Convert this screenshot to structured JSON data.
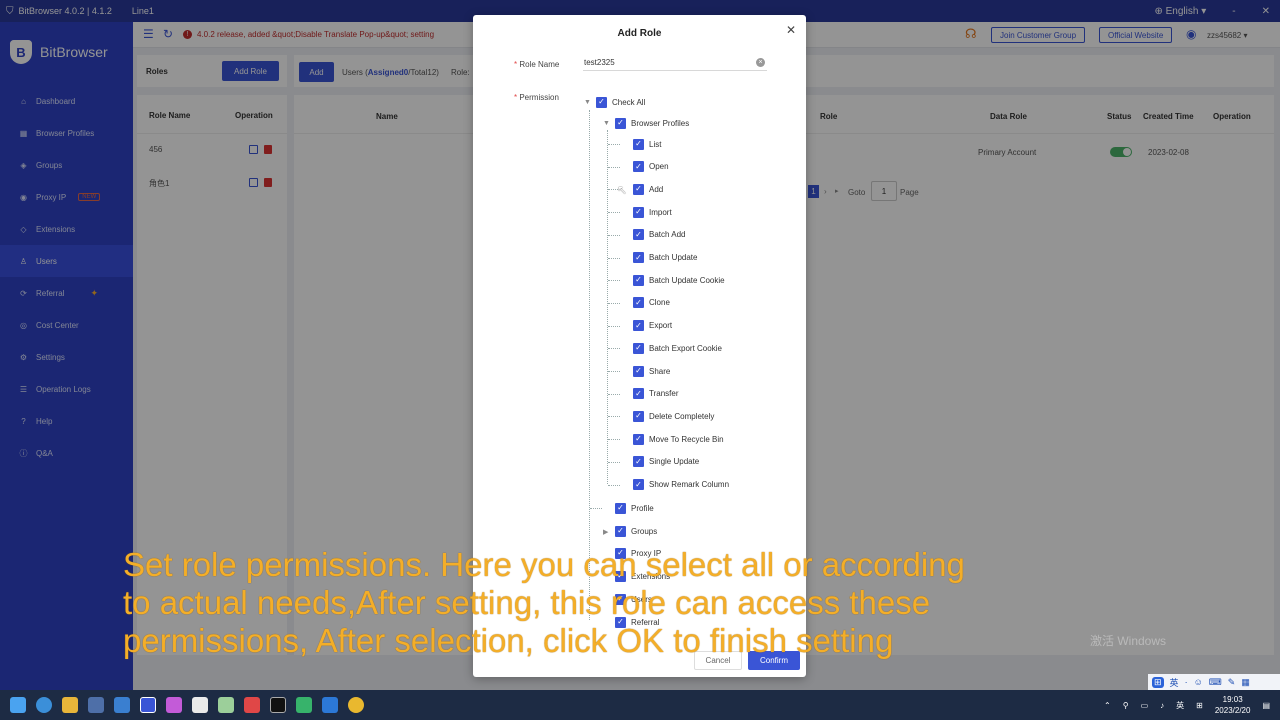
{
  "titlebar": {
    "app": "BitBrowser 4.0.2 | 4.1.2",
    "line": "Line1",
    "language": "English",
    "minimize": "-",
    "close": "✕"
  },
  "sidebar": {
    "logo": "BitBrowser",
    "items": [
      {
        "icon": "dashboard-icon",
        "glyph": "⌂",
        "label": "Dashboard"
      },
      {
        "icon": "browser-profiles-icon",
        "glyph": "▦",
        "label": "Browser Profiles"
      },
      {
        "icon": "groups-icon",
        "glyph": "◈",
        "label": "Groups"
      },
      {
        "icon": "proxy-icon",
        "glyph": "◉",
        "label": "Proxy IP",
        "badge": "NEW"
      },
      {
        "icon": "extensions-icon",
        "glyph": "◇",
        "label": "Extensions"
      },
      {
        "icon": "users-icon",
        "glyph": "♙",
        "label": "Users",
        "active": true
      },
      {
        "icon": "referral-icon",
        "glyph": "⟳",
        "label": "Referral",
        "star": "✦"
      },
      {
        "icon": "cost-center-icon",
        "glyph": "◎",
        "label": "Cost Center"
      },
      {
        "icon": "settings-icon",
        "glyph": "⚙",
        "label": "Settings"
      },
      {
        "icon": "operation-logs-icon",
        "glyph": "☰",
        "label": "Operation Logs"
      },
      {
        "icon": "help-icon",
        "glyph": "?",
        "label": "Help"
      },
      {
        "icon": "qa-icon",
        "glyph": "ⓘ",
        "label": "Q&A"
      }
    ]
  },
  "topbar": {
    "notice": "4.0.2 release, added &quot;Disable Translate Pop-up&quot; setting",
    "join_group": "Join Customer Group",
    "official_website": "Official Website",
    "username": "zzs45682"
  },
  "roles_panel": {
    "title": "Roles",
    "add_role": "Add Role",
    "col_role_name": "Role Name",
    "col_operation": "Operation",
    "rows": [
      "456",
      "角色1"
    ]
  },
  "users_panel": {
    "add": "Add",
    "users_label": "Users (",
    "assigned": "Assigned0",
    "total": "/Total12)",
    "role_label": "Role:",
    "columns": {
      "name": "Name",
      "role": "Role",
      "data_role": "Data Role",
      "status": "Status",
      "created": "Created Time",
      "operation": "Operation"
    },
    "row": {
      "data_role": "Primary Account",
      "created": "2023-02-08"
    },
    "pagination": {
      "page": "1",
      "goto": "Goto",
      "goto_value": "1",
      "page_label": "Page"
    }
  },
  "modal": {
    "title": "Add Role",
    "role_name_label": "Role Name",
    "role_name_value": "test2325",
    "permission_label": "Permission",
    "check_all": "Check All",
    "browser_profiles": "Browser Profiles",
    "children": [
      "List",
      "Open",
      "Add",
      "Import",
      "Batch Add",
      "Batch Update",
      "Batch Update Cookie",
      "Clone",
      "Export",
      "Batch Export Cookie",
      "Share",
      "Transfer",
      "Delete Completely",
      "Move To Recycle Bin",
      "Single Update",
      "Show Remark Column"
    ],
    "others": [
      "Profile",
      "Groups",
      "Proxy IP",
      "Extensions",
      "Users",
      "Referral"
    ],
    "cancel": "Cancel",
    "confirm": "Confirm"
  },
  "caption": {
    "line1": "Set role permissions. Here you can select all or according",
    "line2": "to actual needs,After setting, this role can access these",
    "line3": "permissions,  After selection, click OK to finish setting"
  },
  "watermark": "激活 Windows",
  "ime": {
    "mode": "英"
  },
  "taskbar": {
    "time": "19:03",
    "date": "2023/2/20",
    "lang": "英"
  }
}
